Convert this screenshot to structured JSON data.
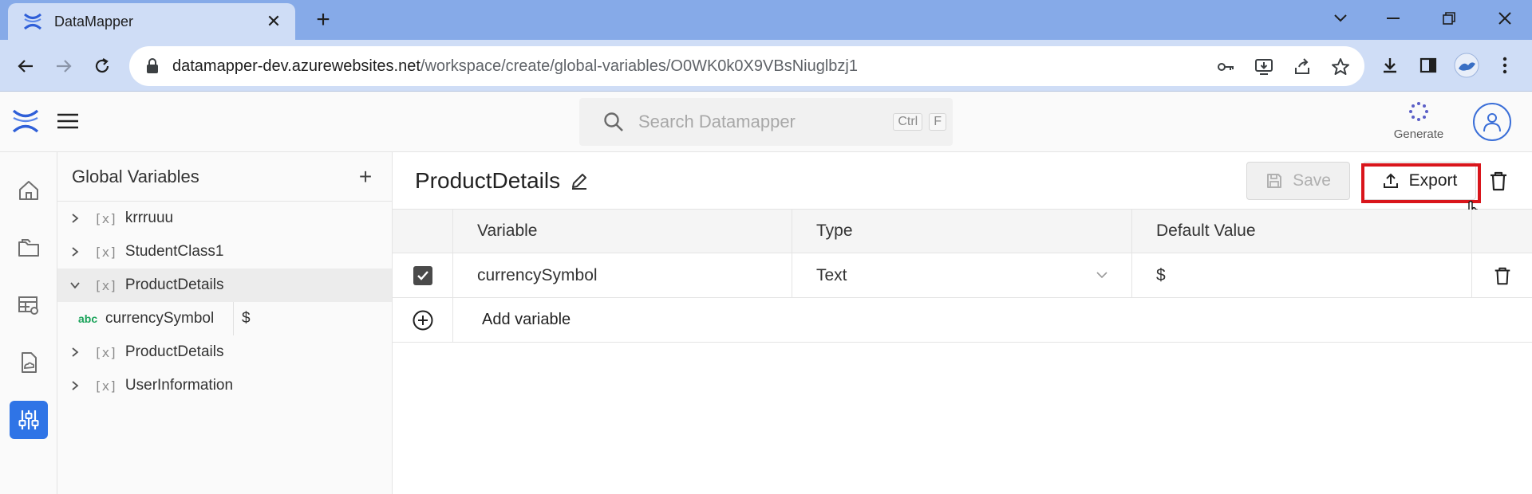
{
  "browser": {
    "tab_title": "DataMapper",
    "url_host": "datamapper-dev.azurewebsites.net",
    "url_path": "/workspace/create/global-variables/O0WK0k0X9VBsNiuglbzj1"
  },
  "header": {
    "search_placeholder": "Search Datamapper",
    "shortcut_ctrl": "Ctrl",
    "shortcut_key": "F",
    "generate_label": "Generate"
  },
  "panel": {
    "title": "Global Variables",
    "var_marker": "[x]",
    "items": [
      {
        "name": "krrruuu"
      },
      {
        "name": "StudentClass1"
      },
      {
        "name": "ProductDetails"
      },
      {
        "name": "ProductDetails"
      },
      {
        "name": "UserInformation"
      }
    ],
    "child": {
      "type_badge": "abc",
      "name": "currencySymbol",
      "value": "$"
    }
  },
  "main": {
    "title": "ProductDetails",
    "save_label": "Save",
    "export_label": "Export",
    "columns": {
      "variable": "Variable",
      "type": "Type",
      "default": "Default Value"
    },
    "row": {
      "variable": "currencySymbol",
      "type": "Text",
      "default": "$"
    },
    "add_label": "Add variable"
  },
  "colors": {
    "accent": "#2f74e6",
    "highlight": "#d9151b",
    "type_badge": "#1aa35a"
  }
}
